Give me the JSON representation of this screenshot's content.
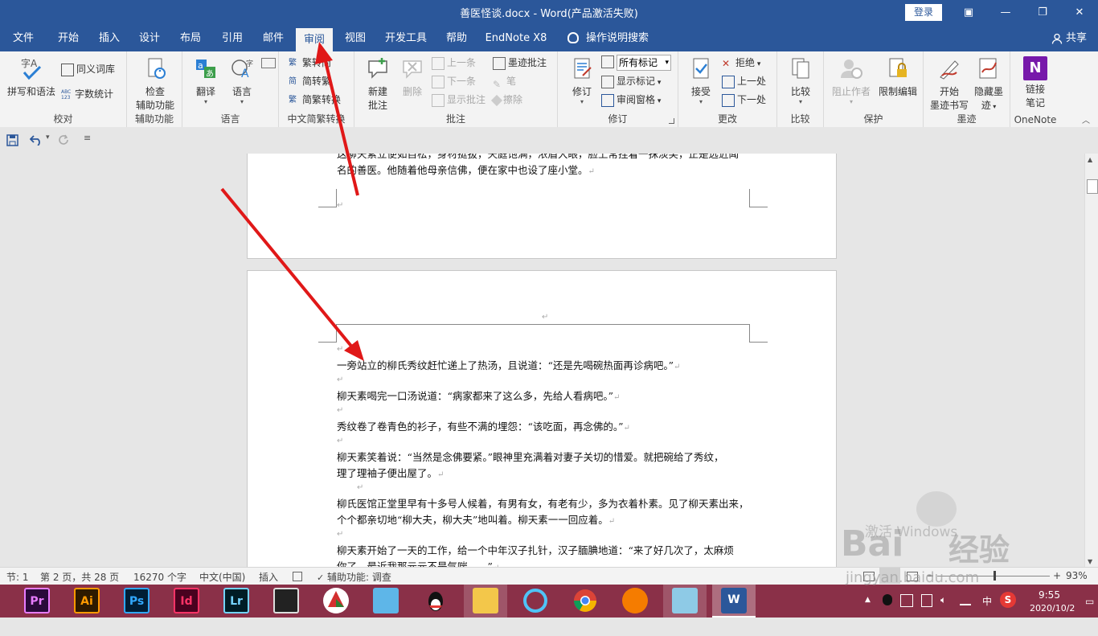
{
  "titlebar": {
    "title": "善医怪谈.docx  -  Word(产品激活失败)",
    "login": "登录",
    "restore_ribbon": "▣",
    "minimize": "—",
    "maximize": "❐",
    "close": "✕"
  },
  "tabs": [
    {
      "label": "文件"
    },
    {
      "label": "开始"
    },
    {
      "label": "插入"
    },
    {
      "label": "设计"
    },
    {
      "label": "布局"
    },
    {
      "label": "引用"
    },
    {
      "label": "邮件"
    },
    {
      "label": "审阅"
    },
    {
      "label": "视图"
    },
    {
      "label": "开发工具"
    },
    {
      "label": "帮助"
    },
    {
      "label": "EndNote X8"
    }
  ],
  "tell_me": "操作说明搜索",
  "share": "共享",
  "ribbon": {
    "proofing": {
      "label": "校对",
      "spelling": "拼写和语法",
      "thesaurus": "同义词库",
      "word_count": "字数统计",
      "abc_glyph": "ABC\n123",
      "spell_glyph": "字A"
    },
    "accessibility": {
      "label": "辅助功能",
      "check_line1": "检查",
      "check_line2": "辅助功能"
    },
    "language": {
      "label": "语言",
      "translate": "翻译",
      "language": "语言"
    },
    "chinese": {
      "label": "中文简繁转换",
      "to_simplified": "繁转简",
      "to_traditional": "简转繁",
      "convert": "简繁转换",
      "fan": "繁",
      "jian": "简"
    },
    "comments": {
      "label": "批注",
      "new_comment_line1": "新建",
      "new_comment_line2": "批注",
      "delete": "删除",
      "previous": "上一条",
      "next": "下一条",
      "show_comments": "显示批注",
      "ink_comment": "墨迹批注",
      "pen": "笔",
      "eraser": "擦除"
    },
    "tracking": {
      "label": "修订",
      "track": "修订",
      "markup_select": "所有标记",
      "show_markup": "显示标记",
      "review_pane": "审阅窗格"
    },
    "changes": {
      "label": "更改",
      "accept": "接受",
      "reject": "拒绝",
      "previous": "上一处",
      "next": "下一处"
    },
    "compare": {
      "label": "比较",
      "compare": "比较"
    },
    "protect": {
      "label": "保护",
      "block_authors": "阻止作者",
      "restrict_editing": "限制编辑"
    },
    "ink": {
      "label": "墨迹",
      "start_line1": "开始",
      "start_line2": "墨迹书写",
      "hide_line1": "隐藏墨",
      "hide_line2": "迹"
    },
    "onenote": {
      "label": "OneNote",
      "link_line1": "链接",
      "link_line2": "笔记",
      "logo": "N"
    }
  },
  "document": {
    "page1": [
      "这柳天素立便如自松，身材挺拔，天庭饱满，浓眉大眼，脸上常挂着一抹淡笑，正是远近闻",
      "名的善医。他随着他母亲信佛，便在家中也设了座小堂。"
    ],
    "page2": [
      "一旁站立的柳氏秀纹赶忙递上了热汤，且说道：“还是先喝碗热面再诊病吧。”",
      "柳天素喝完一口汤说道：“病家都来了这么多，先给人看病吧。”",
      "秀纹卷了卷青色的衫子，有些不满的埋怨：“该吃面，再念佛的。”",
      "柳天素笑着说：“当然是念佛要紧。”眼神里充满着对妻子关切的惜爱。就把碗给了秀纹，",
      "理了理袖子便出屋了。",
      "柳氏医馆正堂里早有十多号人候着，有男有女，有老有少，多为衣着朴素。见了柳天素出来，",
      "个个都亲切地“柳大夫，柳大夫”地叫着。柳天素一一回应着。",
      "柳天素开始了一天的工作，给一个中年汉子扎针，汉子腼腆地道：“来了好几次了，太麻烦",
      "你了，最近我那元元不是气喘……”"
    ],
    "para_mark": "↵"
  },
  "statusbar": {
    "section": "节: 1",
    "page": "第 2 页，共 28 页",
    "words": "16270 个字",
    "language": "中文(中国)",
    "mode": "插入",
    "accessibility": "辅助功能: 调查",
    "zoom": "93%",
    "zoom_minus": "−",
    "zoom_plus": "+"
  },
  "taskbar": {
    "apps": [
      {
        "label": "Pr",
        "color": "#2a0a3a",
        "fg": "#e77cff"
      },
      {
        "label": "Ai",
        "color": "#2e1a00",
        "fg": "#ff9a00"
      },
      {
        "label": "Ps",
        "color": "#001e36",
        "fg": "#31a8ff"
      },
      {
        "label": "Id",
        "color": "#49021f",
        "fg": "#ff3366"
      },
      {
        "label": "Lr",
        "color": "#001d26",
        "fg": "#74d3ff"
      }
    ],
    "time": "9:55",
    "date": "2020/10/2",
    "ime": "中",
    "ime2": "S"
  },
  "watermark": {
    "text1": "激活 Windows",
    "text2": "Bai",
    "text3": "经验",
    "text4": "jingyan.baidu.com"
  }
}
